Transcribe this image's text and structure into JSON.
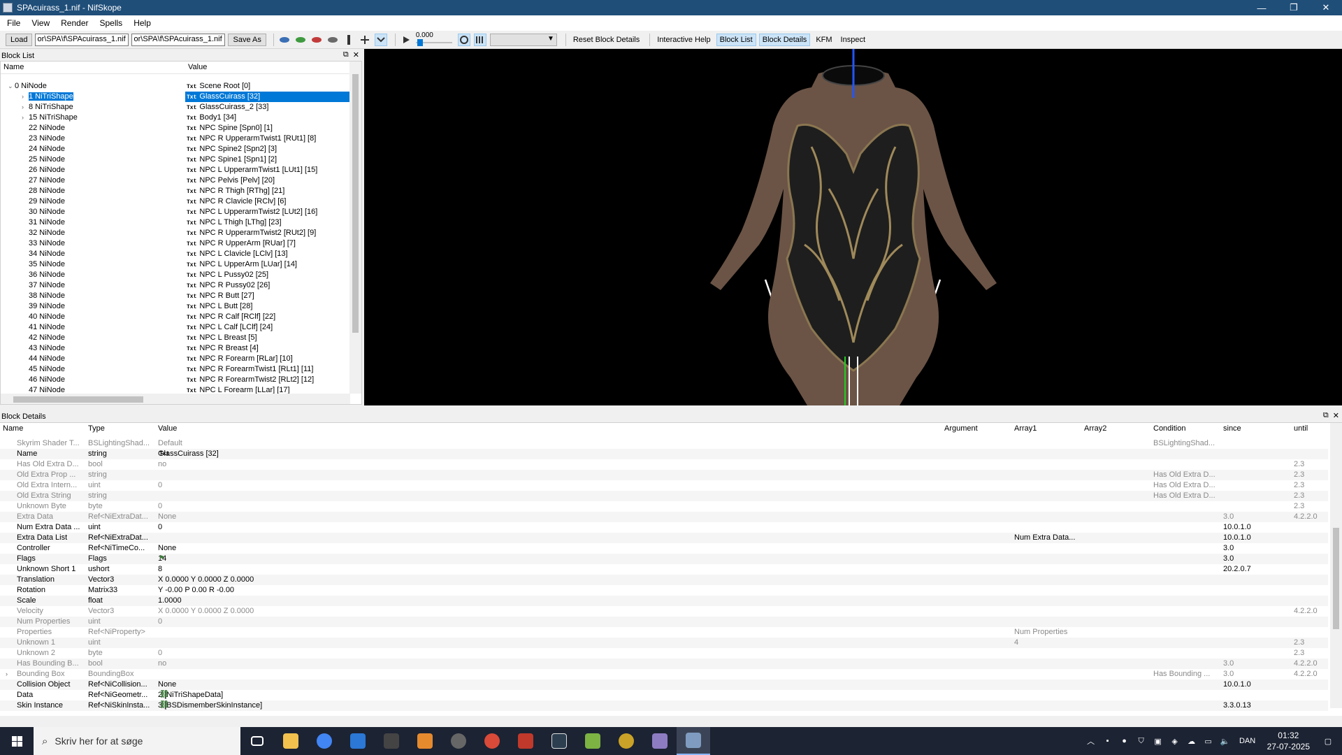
{
  "window": {
    "title": "SPAcuirass_1.nif - NifSkope",
    "controls": [
      "—",
      "❐",
      "✕"
    ]
  },
  "menu": [
    "File",
    "View",
    "Render",
    "Spells",
    "Help"
  ],
  "toolbar": {
    "load_label": "Load",
    "load_path": "or\\SPA\\f\\SPAcuirass_1.nif",
    "save_path": "or\\SPA\\f\\SPAcuirass_1.nif",
    "saveas_label": "Save As",
    "anim_time": "0.000",
    "links": [
      "Reset Block Details",
      "Interactive Help",
      "Block List",
      "Block Details",
      "KFM",
      "Inspect"
    ]
  },
  "blocklist": {
    "panel_title": "Block List",
    "col_name": "Name",
    "col_value": "Value",
    "rows": [
      {
        "name": "0 NiNode",
        "value": "Scene Root [0]",
        "indent": 0,
        "expand": "open"
      },
      {
        "name": "1 NiTriShape",
        "value": "GlassCuirass [32]",
        "indent": 1,
        "expand": "closed",
        "selected": true
      },
      {
        "name": "8 NiTriShape",
        "value": "GlassCuirass_2 [33]",
        "indent": 1,
        "expand": "closed"
      },
      {
        "name": "15 NiTriShape",
        "value": "Body1 [34]",
        "indent": 1,
        "expand": "closed"
      },
      {
        "name": "22 NiNode",
        "value": "NPC Spine [Spn0] [1]",
        "indent": 1
      },
      {
        "name": "23 NiNode",
        "value": "NPC R UpperarmTwist1 [RUt1] [8]",
        "indent": 1
      },
      {
        "name": "24 NiNode",
        "value": "NPC Spine2 [Spn2] [3]",
        "indent": 1
      },
      {
        "name": "25 NiNode",
        "value": "NPC Spine1 [Spn1] [2]",
        "indent": 1
      },
      {
        "name": "26 NiNode",
        "value": "NPC L UpperarmTwist1 [LUt1] [15]",
        "indent": 1
      },
      {
        "name": "27 NiNode",
        "value": "NPC Pelvis [Pelv] [20]",
        "indent": 1
      },
      {
        "name": "28 NiNode",
        "value": "NPC R Thigh [RThg] [21]",
        "indent": 1
      },
      {
        "name": "29 NiNode",
        "value": "NPC R Clavicle [RClv] [6]",
        "indent": 1
      },
      {
        "name": "30 NiNode",
        "value": "NPC L UpperarmTwist2 [LUt2] [16]",
        "indent": 1
      },
      {
        "name": "31 NiNode",
        "value": "NPC L Thigh [LThg] [23]",
        "indent": 1
      },
      {
        "name": "32 NiNode",
        "value": "NPC R UpperarmTwist2 [RUt2] [9]",
        "indent": 1
      },
      {
        "name": "33 NiNode",
        "value": "NPC R UpperArm [RUar] [7]",
        "indent": 1
      },
      {
        "name": "34 NiNode",
        "value": "NPC L Clavicle [LClv] [13]",
        "indent": 1
      },
      {
        "name": "35 NiNode",
        "value": "NPC L UpperArm [LUar] [14]",
        "indent": 1
      },
      {
        "name": "36 NiNode",
        "value": "NPC L Pussy02 [25]",
        "indent": 1
      },
      {
        "name": "37 NiNode",
        "value": "NPC R Pussy02 [26]",
        "indent": 1
      },
      {
        "name": "38 NiNode",
        "value": "NPC R Butt [27]",
        "indent": 1
      },
      {
        "name": "39 NiNode",
        "value": "NPC L Butt [28]",
        "indent": 1
      },
      {
        "name": "40 NiNode",
        "value": "NPC R Calf [RClf] [22]",
        "indent": 1
      },
      {
        "name": "41 NiNode",
        "value": "NPC L Calf [LClf] [24]",
        "indent": 1
      },
      {
        "name": "42 NiNode",
        "value": "NPC L Breast [5]",
        "indent": 1
      },
      {
        "name": "43 NiNode",
        "value": "NPC R Breast [4]",
        "indent": 1
      },
      {
        "name": "44 NiNode",
        "value": "NPC R Forearm [RLar] [10]",
        "indent": 1
      },
      {
        "name": "45 NiNode",
        "value": "NPC R ForearmTwist1 [RLt1] [11]",
        "indent": 1
      },
      {
        "name": "46 NiNode",
        "value": "NPC R ForearmTwist2 [RLt2] [12]",
        "indent": 1
      },
      {
        "name": "47 NiNode",
        "value": "NPC L Forearm [LLar] [17]",
        "indent": 1
      }
    ]
  },
  "details": {
    "panel_title": "Block Details",
    "columns": [
      "Name",
      "Type",
      "Value",
      "Argument",
      "Array1",
      "Array2",
      "Condition",
      "since",
      "until"
    ],
    "rows": [
      {
        "name": "Skyrim Shader T...",
        "type": "BSLightingShad...",
        "value": "Default",
        "arg": "",
        "a1": "",
        "a2": "",
        "cond": "BSLightingShad...",
        "since": "",
        "until": "",
        "dim": true
      },
      {
        "name": "Name",
        "type": "string",
        "value": "GlassCuirass [32]",
        "icon": "txt",
        "arg": "",
        "a1": "",
        "a2": "",
        "cond": "",
        "since": "",
        "until": ""
      },
      {
        "name": "Has Old Extra D...",
        "type": "bool",
        "value": "no",
        "arg": "",
        "a1": "",
        "a2": "",
        "cond": "",
        "since": "",
        "until": "2.3",
        "dim": true
      },
      {
        "name": "Old Extra Prop ...",
        "type": "string",
        "value": "",
        "icon": "txt",
        "arg": "",
        "a1": "",
        "a2": "",
        "cond": "Has Old Extra D...",
        "since": "",
        "until": "2.3",
        "dim": true
      },
      {
        "name": "Old Extra Intern...",
        "type": "uint",
        "value": "0",
        "arg": "",
        "a1": "",
        "a2": "",
        "cond": "Has Old Extra D...",
        "since": "",
        "until": "2.3",
        "dim": true
      },
      {
        "name": "Old Extra String",
        "type": "string",
        "value": "",
        "icon": "txt",
        "arg": "",
        "a1": "",
        "a2": "",
        "cond": "Has Old Extra D...",
        "since": "",
        "until": "2.3",
        "dim": true
      },
      {
        "name": "Unknown Byte",
        "type": "byte",
        "value": "0",
        "arg": "",
        "a1": "",
        "a2": "",
        "cond": "",
        "since": "",
        "until": "2.3",
        "dim": true
      },
      {
        "name": "Extra Data",
        "type": "Ref<NiExtraDat...",
        "value": "None",
        "arg": "",
        "a1": "",
        "a2": "",
        "cond": "",
        "since": "3.0",
        "until": "4.2.2.0",
        "dim": true
      },
      {
        "name": "Num Extra Data ...",
        "type": "uint",
        "value": "0",
        "arg": "",
        "a1": "",
        "a2": "",
        "cond": "",
        "since": "10.0.1.0",
        "until": ""
      },
      {
        "name": "Extra Data List",
        "type": "Ref<NiExtraDat...",
        "value": "",
        "icon": "gear",
        "arg": "",
        "a1": "Num Extra Data...",
        "a2": "",
        "cond": "",
        "since": "10.0.1.0",
        "until": ""
      },
      {
        "name": "Controller",
        "type": "Ref<NiTimeCo...",
        "value": "None",
        "arg": "",
        "a1": "",
        "a2": "",
        "cond": "",
        "since": "3.0",
        "until": ""
      },
      {
        "name": "Flags",
        "type": "Flags",
        "value": "14",
        "icon": "flag",
        "arg": "",
        "a1": "",
        "a2": "",
        "cond": "",
        "since": "3.0",
        "until": ""
      },
      {
        "name": "Unknown Short 1",
        "type": "ushort",
        "value": "8",
        "arg": "",
        "a1": "",
        "a2": "",
        "cond": "",
        "since": "20.2.0.7",
        "until": ""
      },
      {
        "name": "Translation",
        "type": "Vector3",
        "value": "X 0.0000 Y 0.0000 Z 0.0000",
        "arg": "",
        "a1": "",
        "a2": "",
        "cond": "",
        "since": "",
        "until": ""
      },
      {
        "name": "Rotation",
        "type": "Matrix33",
        "value": "Y -0.00 P 0.00 R -0.00",
        "arg": "",
        "a1": "",
        "a2": "",
        "cond": "",
        "since": "",
        "until": ""
      },
      {
        "name": "Scale",
        "type": "float",
        "value": "1.0000",
        "arg": "",
        "a1": "",
        "a2": "",
        "cond": "",
        "since": "",
        "until": ""
      },
      {
        "name": "Velocity",
        "type": "Vector3",
        "value": "X 0.0000 Y 0.0000 Z 0.0000",
        "arg": "",
        "a1": "",
        "a2": "",
        "cond": "",
        "since": "",
        "until": "4.2.2.0",
        "dim": true
      },
      {
        "name": "Num Properties",
        "type": "uint",
        "value": "0",
        "arg": "",
        "a1": "",
        "a2": "",
        "cond": "",
        "since": "",
        "until": "",
        "dim": true
      },
      {
        "name": "Properties",
        "type": "Ref<NiProperty>",
        "value": "",
        "arg": "",
        "a1": "Num Properties",
        "a2": "",
        "cond": "",
        "since": "",
        "until": "",
        "dim": true
      },
      {
        "name": "Unknown 1",
        "type": "uint",
        "value": "",
        "arg": "",
        "a1": "4",
        "a2": "",
        "cond": "",
        "since": "",
        "until": "2.3",
        "dim": true
      },
      {
        "name": "Unknown 2",
        "type": "byte",
        "value": "0",
        "arg": "",
        "a1": "",
        "a2": "",
        "cond": "",
        "since": "",
        "until": "2.3",
        "dim": true
      },
      {
        "name": "Has Bounding B...",
        "type": "bool",
        "value": "no",
        "arg": "",
        "a1": "",
        "a2": "",
        "cond": "",
        "since": "3.0",
        "until": "4.2.2.0",
        "dim": true
      },
      {
        "name": "Bounding Box",
        "type": "BoundingBox",
        "value": "",
        "arg": "",
        "a1": "",
        "a2": "",
        "cond": "Has Bounding ...",
        "since": "3.0",
        "until": "4.2.2.0",
        "dim": true,
        "expand": true
      },
      {
        "name": "Collision Object",
        "type": "Ref<NiCollision...",
        "value": "None",
        "arg": "",
        "a1": "",
        "a2": "",
        "cond": "",
        "since": "10.0.1.0",
        "until": ""
      },
      {
        "name": "Data",
        "type": "Ref<NiGeometr...",
        "value": "2 [NiTriShapeData]",
        "icon": "link",
        "arg": "",
        "a1": "",
        "a2": "",
        "cond": "",
        "since": "",
        "until": ""
      },
      {
        "name": "Skin Instance",
        "type": "Ref<NiSkinInsta...",
        "value": "3 [BSDismemberSkinInstance]",
        "icon": "link",
        "arg": "",
        "a1": "",
        "a2": "",
        "cond": "",
        "since": "3.3.0.13",
        "until": ""
      }
    ]
  },
  "taskbar": {
    "search_placeholder": "Skriv her for at søge",
    "lang": "DAN",
    "time": "01:32",
    "date": "27-07-2025"
  },
  "colors": {
    "titlebar": "#1f4e79",
    "selection": "#0078d7",
    "taskbar": "#1c2333"
  }
}
